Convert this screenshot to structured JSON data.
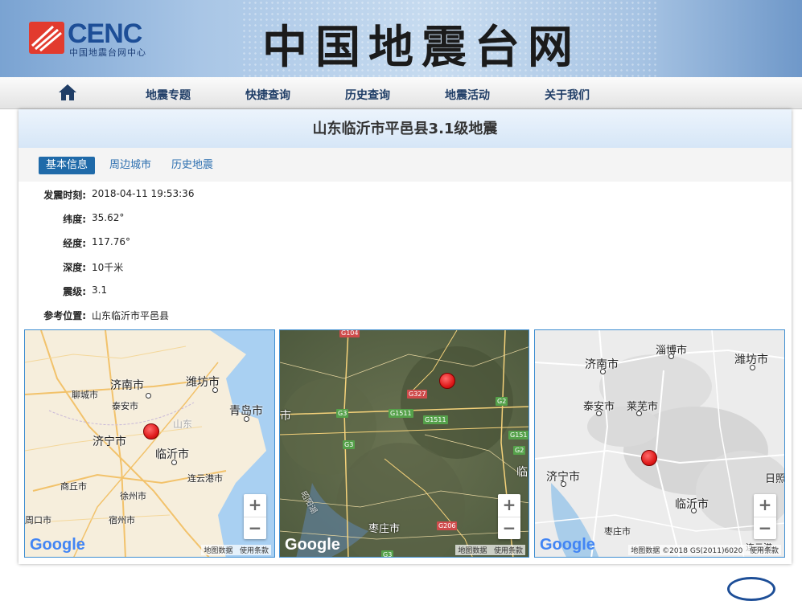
{
  "header": {
    "logo_text": "CENC",
    "logo_subtitle": "中国地震台网中心",
    "site_title": "中国地震台网"
  },
  "nav": {
    "home_icon": "home-icon",
    "items": [
      {
        "label": "地震专题"
      },
      {
        "label": "快捷查询"
      },
      {
        "label": "历史查询"
      },
      {
        "label": "地震活动"
      },
      {
        "label": "关于我们"
      }
    ]
  },
  "page": {
    "title": "山东临沂市平邑县3.1级地震"
  },
  "tabs": [
    {
      "label": "基本信息",
      "active": true
    },
    {
      "label": "周边城市",
      "active": false
    },
    {
      "label": "历史地震",
      "active": false
    }
  ],
  "info": [
    {
      "label": "发震时刻:",
      "value": "2018-04-11 19:53:36"
    },
    {
      "label": "纬度:",
      "value": "35.62°"
    },
    {
      "label": "经度:",
      "value": "117.76°"
    },
    {
      "label": "深度:",
      "value": "10千米"
    },
    {
      "label": "震级:",
      "value": "3.1"
    },
    {
      "label": "参考位置:",
      "value": "山东临沂市平邑县"
    }
  ],
  "maps": {
    "map1": {
      "labels": [
        "济南市",
        "潍坊市",
        "聊城市",
        "泰安市",
        "青岛市",
        "山东",
        "济宁市",
        "临沂市",
        "连云港市",
        "商丘市",
        "徐州市",
        "宿州市",
        "周口市"
      ],
      "google": "Google",
      "attr_data": "地图数据",
      "attr_terms": "使用条款"
    },
    "map2": {
      "labels": [
        "市",
        "枣庄市",
        "临",
        "昭阳湖"
      ],
      "roads": [
        "G104",
        "G327",
        "G3",
        "G1511",
        "G1511",
        "G2",
        "G3",
        "G151",
        "G2",
        "G206",
        "G3"
      ],
      "google": "Google",
      "attr_data": "地图数据",
      "attr_terms": "使用条款"
    },
    "map3": {
      "labels": [
        "淄博市",
        "济南市",
        "潍坊市",
        "泰安市",
        "莱芜市",
        "济宁市",
        "日照",
        "临沂市",
        "枣庄市",
        "连云港"
      ],
      "google": "Google",
      "attr_data": "地图数据 ©2018 GS(2011)6020",
      "attr_terms": "使用条款"
    },
    "zoom_in": "+",
    "zoom_out": "−"
  },
  "colors": {
    "accent": "#1f6aa9",
    "nav_text": "#1f3d66",
    "marker": "#e01b1b"
  }
}
